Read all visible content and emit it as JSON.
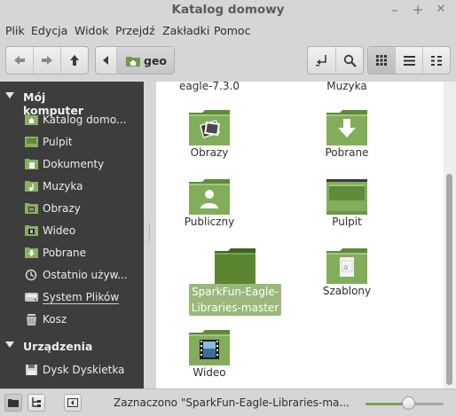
{
  "window": {
    "title": "Katalog domowy",
    "minimize": "–",
    "maximize": "+",
    "close": "✕"
  },
  "menu": [
    "Plik",
    "Edycja",
    "Widok",
    "Przejdź",
    "Zakładki",
    "Pomoc"
  ],
  "toolbar": {
    "path_button": "geo"
  },
  "sidebar": {
    "sections": [
      {
        "title": "Mój komputer",
        "items": [
          {
            "label": "Katalog domo...",
            "icon": "home-folder-icon"
          },
          {
            "label": "Pulpit",
            "icon": "desktop-icon"
          },
          {
            "label": "Dokumenty",
            "icon": "documents-folder-icon"
          },
          {
            "label": "Muzyka",
            "icon": "music-folder-icon"
          },
          {
            "label": "Obrazy",
            "icon": "pictures-folder-icon"
          },
          {
            "label": "Wideo",
            "icon": "videos-folder-icon"
          },
          {
            "label": "Pobrane",
            "icon": "downloads-folder-icon"
          },
          {
            "label": "Ostatnio używ...",
            "icon": "recent-icon"
          },
          {
            "label": "System Plików",
            "icon": "filesystem-icon"
          },
          {
            "label": "Kosz",
            "icon": "trash-icon"
          }
        ]
      },
      {
        "title": "Urządzenia",
        "items": [
          {
            "label": "Dysk Dyskietka",
            "icon": "floppy-icon"
          }
        ]
      }
    ]
  },
  "files": [
    {
      "label": "eagle-7.3.0",
      "emblem": "none"
    },
    {
      "label": "Muzyka",
      "emblem": "music"
    },
    {
      "label": "Obrazy",
      "emblem": "pictures"
    },
    {
      "label": "Pobrane",
      "emblem": "download"
    },
    {
      "label": "Publiczny",
      "emblem": "person"
    },
    {
      "label": "Pulpit",
      "emblem": "desktop"
    },
    {
      "label": "SparkFun-Eagle-\nLibraries-master",
      "emblem": "none",
      "selected": true
    },
    {
      "label": "Szablony",
      "emblem": "templates"
    },
    {
      "label": "Wideo",
      "emblem": "video"
    }
  ],
  "status": {
    "text": "Zaznaczono \"SparkFun-Eagle-Libraries-ma...",
    "zoom_fraction": 0.54
  },
  "colors": {
    "sidebar_bg": "#3d3d3d",
    "accent": "#8ab46a",
    "folder_green": "#7ca654",
    "selection": "#9ab87c"
  }
}
